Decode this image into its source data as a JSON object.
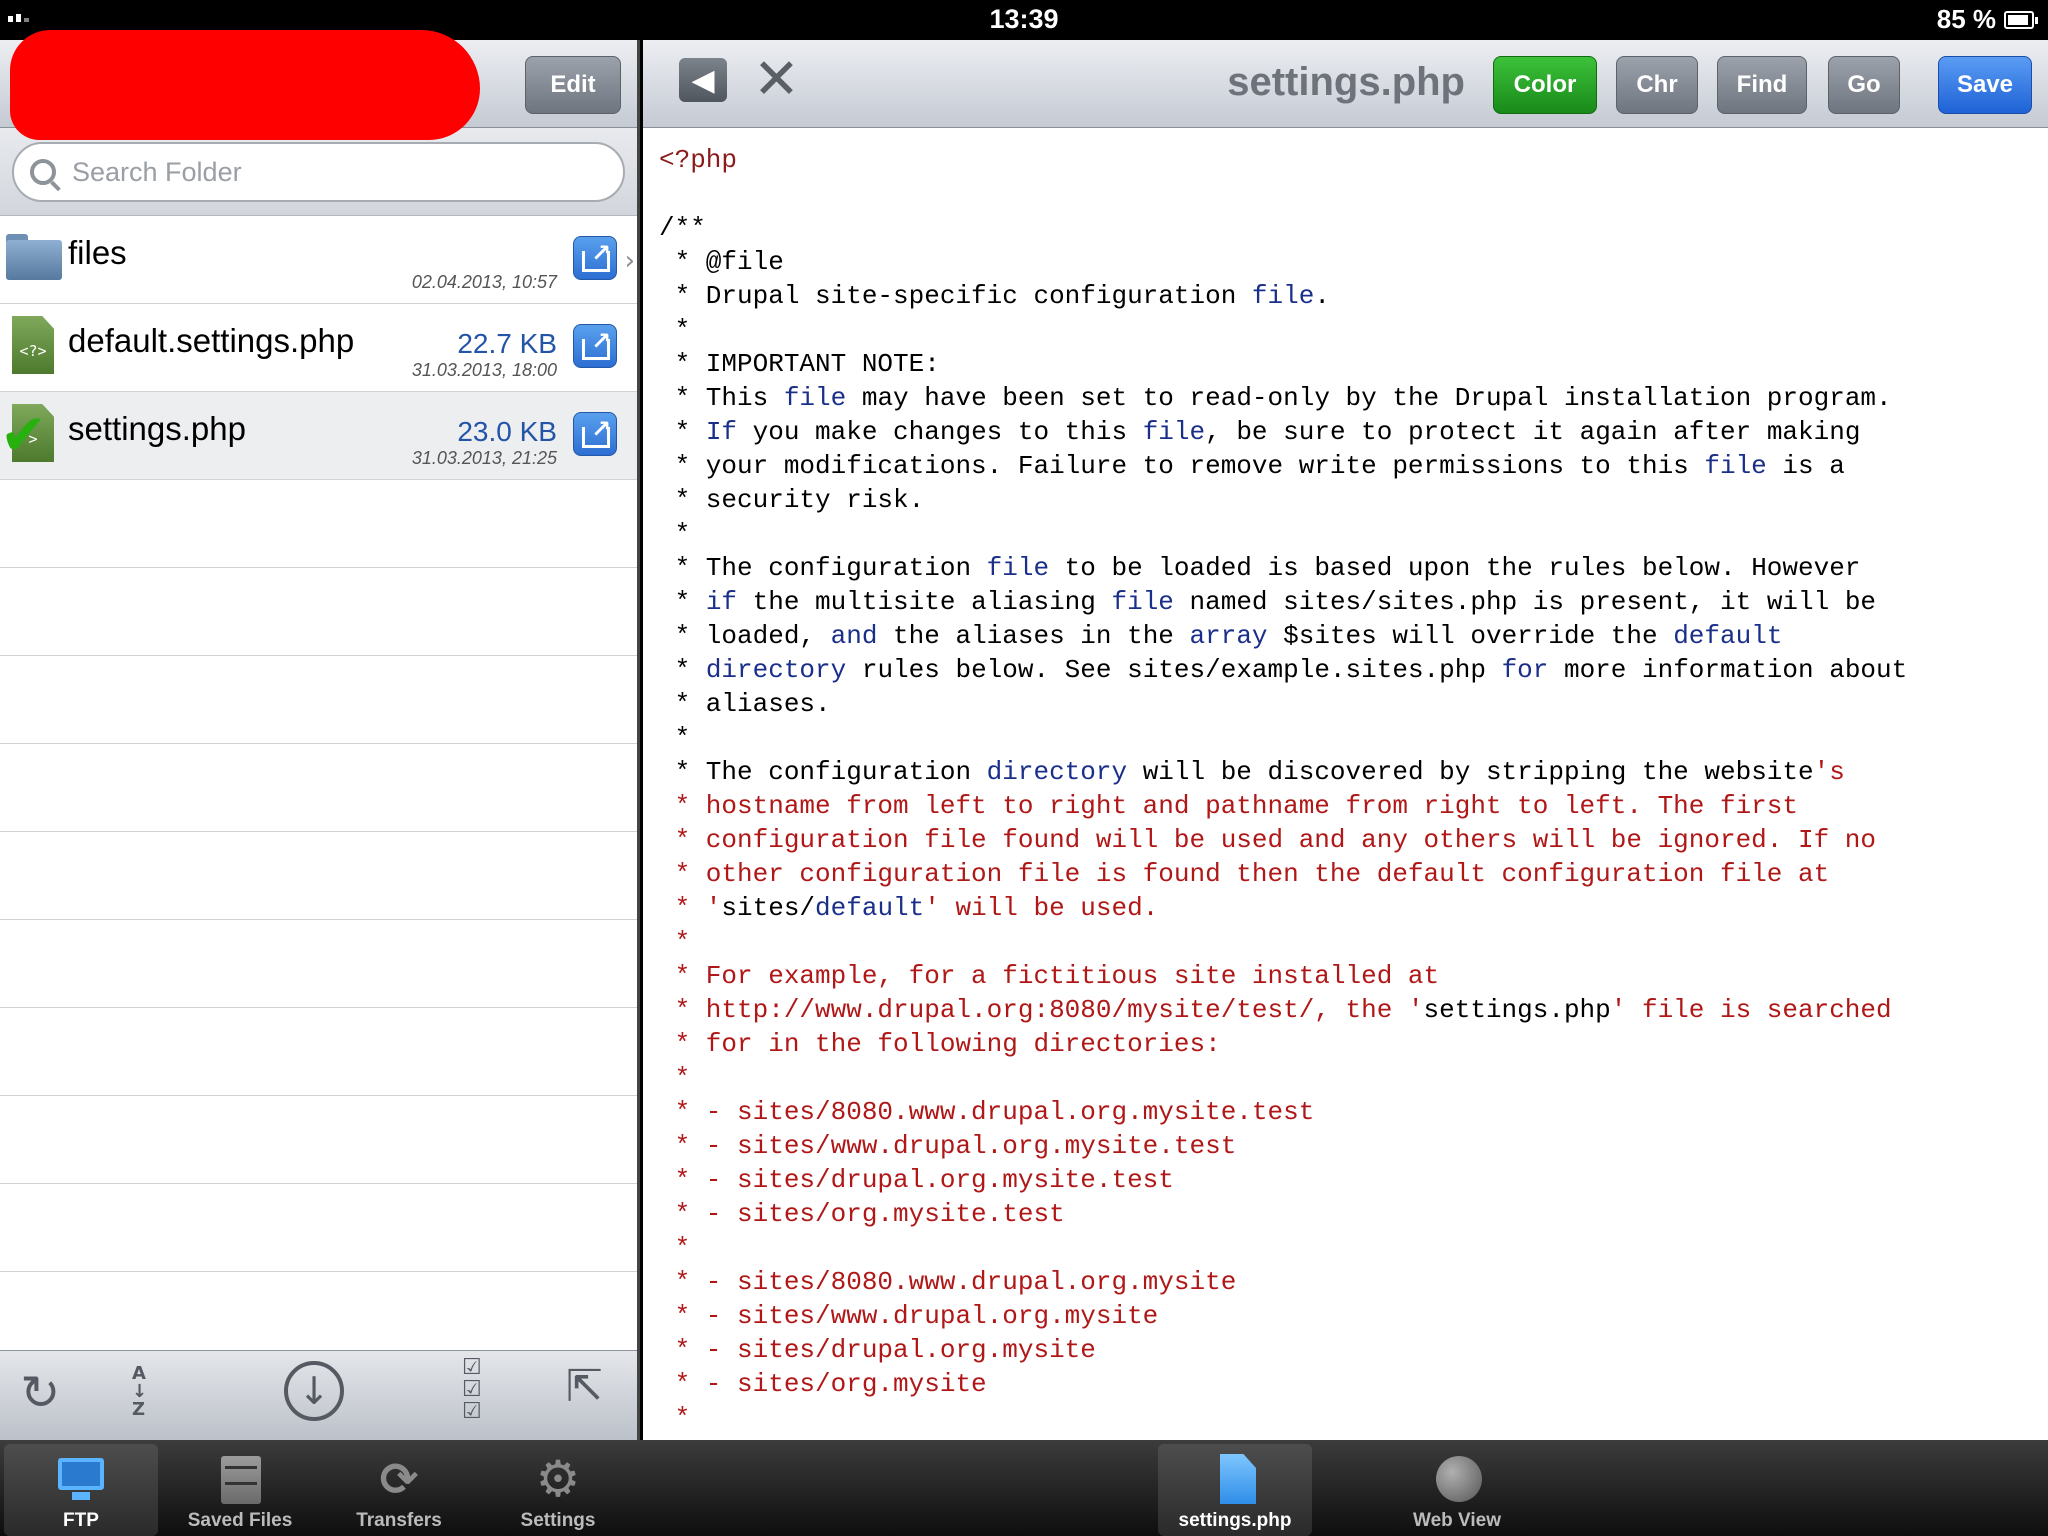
{
  "status": {
    "time": "13:39",
    "battery": "85 %"
  },
  "left": {
    "edit_label": "Edit",
    "search_placeholder": "Search Folder",
    "files": [
      {
        "name": "files",
        "size": "",
        "date": "02.04.2013, 10:57",
        "type": "folder"
      },
      {
        "name": "default.settings.php",
        "size": "22.7 KB",
        "date": "31.03.2013, 18:00",
        "type": "php"
      },
      {
        "name": "settings.php",
        "size": "23.0 KB",
        "date": "31.03.2013, 21:25",
        "type": "php-checked"
      }
    ],
    "toolbar_icons": [
      "refresh-icon",
      "sort-az-icon",
      "download-icon",
      "checklist-icon",
      "export-icon"
    ]
  },
  "editor": {
    "title": "settings.php",
    "buttons": {
      "color": "Color",
      "chr": "Chr",
      "find": "Find",
      "go": "Go",
      "save": "Save"
    },
    "colors": {
      "color_button": "#1f9a1f",
      "save_button": "#2a6fdc",
      "keyword": "#1a2f8a",
      "string": "#b01818"
    }
  },
  "tabs": {
    "left": [
      "FTP",
      "Saved Files",
      "Transfers",
      "Settings"
    ],
    "right": [
      "settings.php",
      "Web View"
    ]
  },
  "code_lines": [
    [
      [
        "tag",
        "<?php"
      ]
    ],
    [],
    [
      [
        "",
        "/**"
      ]
    ],
    [
      [
        "",
        " * @file"
      ]
    ],
    [
      [
        "",
        " * Drupal site-specific configuration "
      ],
      [
        "kw",
        "file"
      ],
      [
        "",
        "."
      ]
    ],
    [
      [
        "",
        " *"
      ]
    ],
    [
      [
        "",
        " * IMPORTANT NOTE:"
      ]
    ],
    [
      [
        "",
        " * This "
      ],
      [
        "kw",
        "file"
      ],
      [
        "",
        " may have been set to read-only by the Drupal installation program."
      ]
    ],
    [
      [
        "",
        " * "
      ],
      [
        "kw",
        "If"
      ],
      [
        "",
        " you make changes to this "
      ],
      [
        "kw",
        "file"
      ],
      [
        "",
        ", be sure to protect it again after making"
      ]
    ],
    [
      [
        "",
        " * your modifications. Failure to remove write permissions to this "
      ],
      [
        "kw",
        "file"
      ],
      [
        "",
        " is a"
      ]
    ],
    [
      [
        "",
        " * security risk."
      ]
    ],
    [
      [
        "",
        " *"
      ]
    ],
    [
      [
        "",
        " * The configuration "
      ],
      [
        "kw",
        "file"
      ],
      [
        "",
        " to be loaded is based upon the rules below. However"
      ]
    ],
    [
      [
        "",
        " * "
      ],
      [
        "kw",
        "if"
      ],
      [
        "",
        " the multisite aliasing "
      ],
      [
        "kw",
        "file"
      ],
      [
        "",
        " named sites/sites.php is present, it will be"
      ]
    ],
    [
      [
        "",
        " * loaded, "
      ],
      [
        "kw",
        "and"
      ],
      [
        "",
        " the aliases in the "
      ],
      [
        "kw",
        "array"
      ],
      [
        "",
        " $sites will override the "
      ],
      [
        "kw",
        "default"
      ]
    ],
    [
      [
        "",
        " * "
      ],
      [
        "kw",
        "directory"
      ],
      [
        "",
        " rules below. See sites/example.sites.php "
      ],
      [
        "kw",
        "for"
      ],
      [
        "",
        " more information about"
      ]
    ],
    [
      [
        "",
        " * aliases."
      ]
    ],
    [
      [
        "",
        " *"
      ]
    ],
    [
      [
        "",
        " * The configuration "
      ],
      [
        "kw",
        "directory"
      ],
      [
        "",
        " will be discovered by stripping the website"
      ],
      [
        "str",
        "'s"
      ]
    ],
    [
      [
        "str",
        " * hostname from left to right and pathname from right to left. The first"
      ]
    ],
    [
      [
        "str",
        " * configuration file found will be used and any others will be ignored. If no"
      ]
    ],
    [
      [
        "str",
        " * other configuration file is found then the default configuration file at"
      ]
    ],
    [
      [
        "str",
        " * '"
      ],
      [
        "",
        "sites/"
      ],
      [
        "kw",
        "default"
      ],
      [
        "str",
        "' will be used."
      ]
    ],
    [
      [
        "str",
        " *"
      ]
    ],
    [
      [
        "str",
        " * For example, for a fictitious site installed at"
      ]
    ],
    [
      [
        "str",
        " * http://www.drupal.org:8080/mysite/test/, the '"
      ],
      [
        "",
        "settings.php"
      ],
      [
        "str",
        "' file is searched"
      ]
    ],
    [
      [
        "str",
        " * for in the following directories:"
      ]
    ],
    [
      [
        "str",
        " *"
      ]
    ],
    [
      [
        "str",
        " * - sites/8080.www.drupal.org.mysite.test"
      ]
    ],
    [
      [
        "str",
        " * - sites/www.drupal.org.mysite.test"
      ]
    ],
    [
      [
        "str",
        " * - sites/drupal.org.mysite.test"
      ]
    ],
    [
      [
        "str",
        " * - sites/org.mysite.test"
      ]
    ],
    [
      [
        "str",
        " *"
      ]
    ],
    [
      [
        "str",
        " * - sites/8080.www.drupal.org.mysite"
      ]
    ],
    [
      [
        "str",
        " * - sites/www.drupal.org.mysite"
      ]
    ],
    [
      [
        "str",
        " * - sites/drupal.org.mysite"
      ]
    ],
    [
      [
        "str",
        " * - sites/org.mysite"
      ]
    ],
    [
      [
        "str",
        " *"
      ]
    ]
  ]
}
